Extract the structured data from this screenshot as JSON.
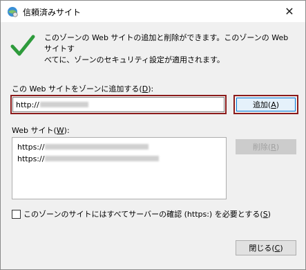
{
  "window": {
    "title": "信頼済みサイト",
    "close_glyph": "✕"
  },
  "description": {
    "line1": "このゾーンの Web サイトの追加と削除ができます。このゾーンの Web サイトす",
    "line2": "べてに、ゾーンのセキュリティ設定が適用されます。"
  },
  "add_section": {
    "label_prefix": "この Web サイトをゾーンに追加する(",
    "label_key": "D",
    "label_suffix": "):",
    "input_value": "http://",
    "add_button_prefix": "追加(",
    "add_button_key": "A",
    "add_button_suffix": ")"
  },
  "websites": {
    "label_prefix": "Web サイト(",
    "label_key": "W",
    "label_suffix": "):",
    "items": [
      {
        "text": "https://"
      },
      {
        "text": "https://"
      }
    ],
    "remove_button_prefix": "削除(",
    "remove_button_key": "R",
    "remove_button_suffix": ")"
  },
  "https_check": {
    "label_prefix": "このゾーンのサイトにはすべてサーバーの確認 (https:) を必要とする(",
    "label_key": "S",
    "label_suffix": ")",
    "checked": false
  },
  "close_button": {
    "prefix": "閉じる(",
    "key": "C",
    "suffix": ")"
  },
  "colors": {
    "accent": "#0078d7",
    "highlight_border": "#8b1a1a",
    "check_green": "#2e9b3c"
  }
}
